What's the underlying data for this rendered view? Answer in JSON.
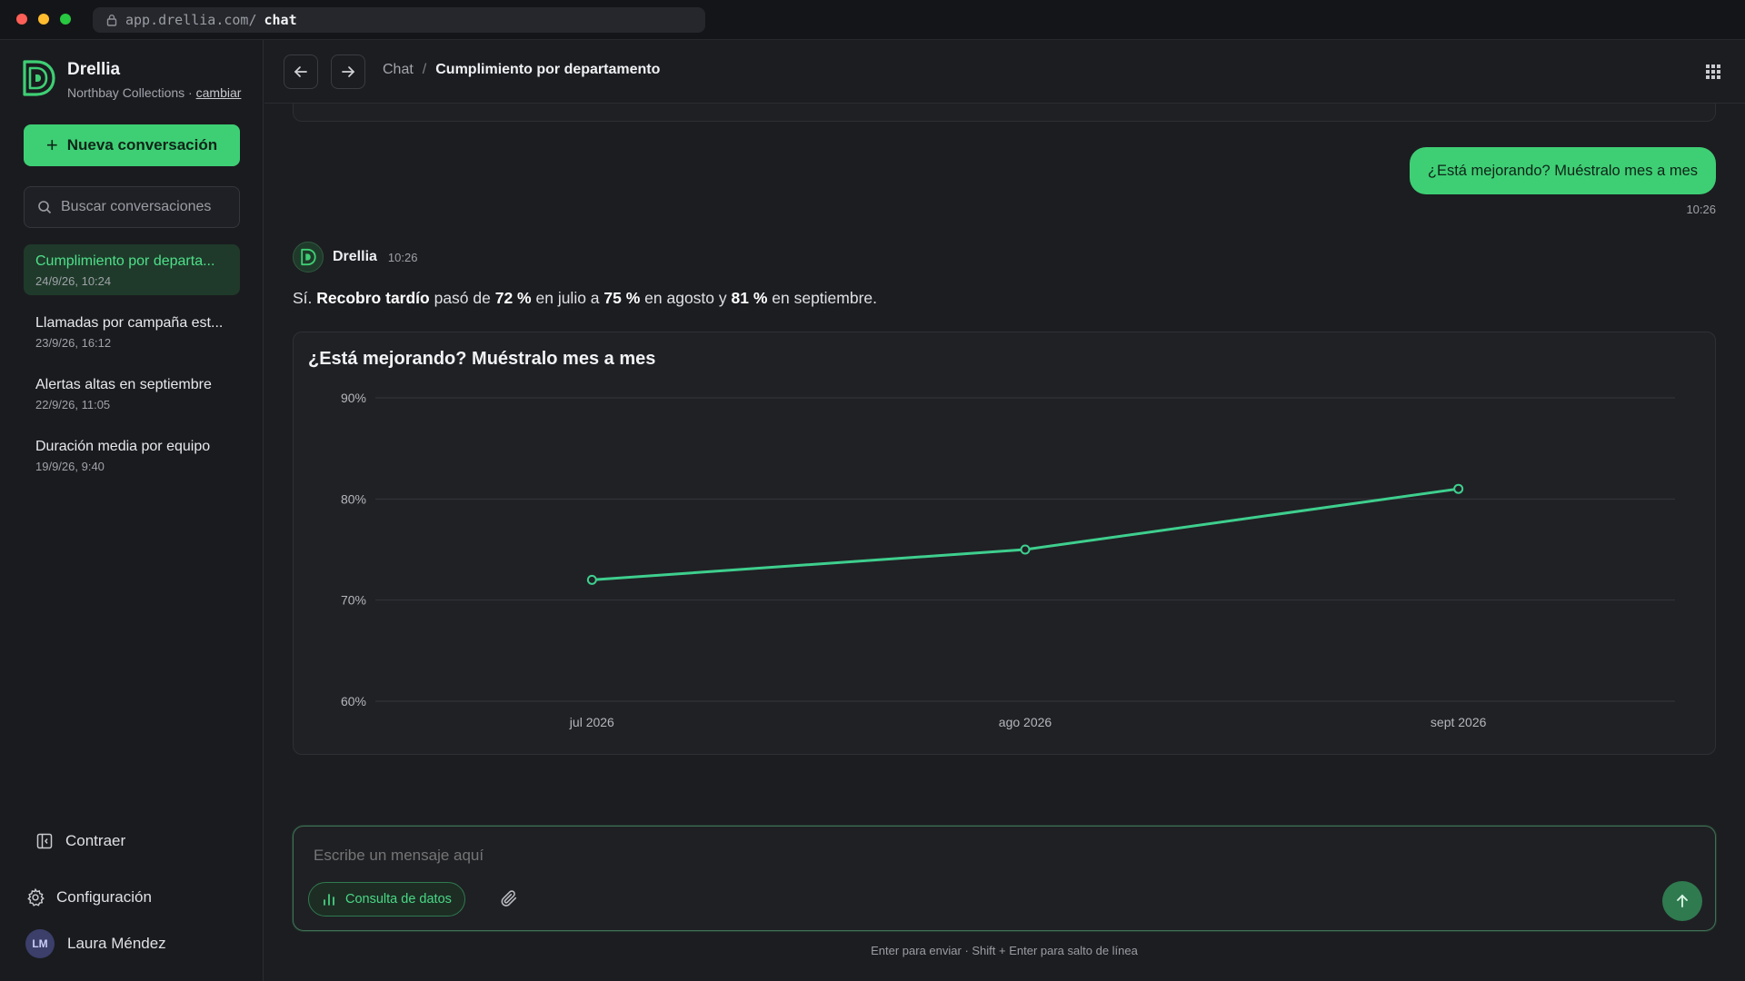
{
  "browser": {
    "url_host": "app.drellia.com/",
    "url_path": "chat"
  },
  "sidebar": {
    "brand_name": "Drellia",
    "workspace": "Northbay Collections",
    "workspace_sep": " · ",
    "switch_label": "cambiar",
    "new_chat_label": "Nueva conversación",
    "search_placeholder": "Buscar conversaciones",
    "conversations": [
      {
        "title": "Cumplimiento por departa...",
        "date": "24/9/26, 10:24",
        "active": true
      },
      {
        "title": "Llamadas por campaña est...",
        "date": "23/9/26, 16:12",
        "active": false
      },
      {
        "title": "Alertas altas en septiembre",
        "date": "22/9/26, 11:05",
        "active": false
      },
      {
        "title": "Duración media por equipo",
        "date": "19/9/26, 9:40",
        "active": false
      }
    ],
    "collapse_label": "Contraer",
    "settings_label": "Configuración",
    "user_initials": "LM",
    "user_name": "Laura Méndez"
  },
  "topbar": {
    "crumb_root": "Chat",
    "crumb_sep": "/",
    "crumb_current": "Cumplimiento por departamento"
  },
  "messages": {
    "user_text": "¿Está mejorando? Muéstralo mes a mes",
    "user_time": "10:26",
    "bot_name": "Drellia",
    "bot_time": "10:26",
    "bot_parts": {
      "p1": "Sí. ",
      "b1": "Recobro tardío",
      "p2": " pasó de ",
      "b2": "72 %",
      "p3": " en julio a ",
      "b3": "75 %",
      "p4": " en agosto y ",
      "b4": "81 %",
      "p5": " en septiembre."
    }
  },
  "chart_data": {
    "type": "line",
    "title": "¿Está mejorando? Muéstralo mes a mes",
    "categories": [
      "jul 2026",
      "ago 2026",
      "sept 2026"
    ],
    "series": [
      {
        "values": [
          72,
          75,
          81
        ]
      }
    ],
    "ylim": [
      60,
      90
    ],
    "yticks": [
      60,
      70,
      80,
      90
    ],
    "ytick_labels": [
      "60%",
      "70%",
      "80%",
      "90%"
    ],
    "grid": true,
    "line_color": "#3ecf8e"
  },
  "composer": {
    "placeholder": "Escribe un mensaje aquí",
    "data_chip_label": "Consulta de datos",
    "hint": "Enter para enviar · Shift + Enter para salto de línea"
  },
  "colors": {
    "accent": "#3ecf74",
    "background": "#1c1d21"
  }
}
